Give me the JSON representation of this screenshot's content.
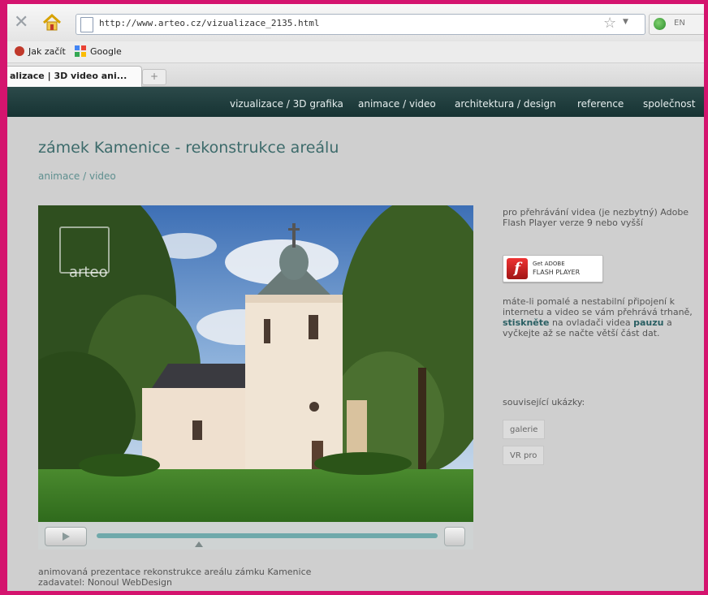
{
  "browser": {
    "url": "http://www.arteo.cz/vizualizace_2135.html",
    "extension_label": "EN",
    "tab_title": "alizace | 3D video ani...",
    "new_tab_symbol": "+",
    "bookmarks": [
      {
        "label": "Jak začít"
      },
      {
        "label": "Google"
      }
    ]
  },
  "site": {
    "nav": [
      {
        "label": "vizualizace / 3D grafika"
      },
      {
        "label": "animace / video"
      },
      {
        "label": "architektura / design"
      },
      {
        "label": "reference"
      },
      {
        "label": "společnost"
      }
    ],
    "page_title": "zámek Kamenice - rekonstrukce areálu",
    "category": "animace / video",
    "video": {
      "logo_text": "arteo",
      "progress": 0.3
    },
    "caption_line1": "animovaná prezentace rekonstrukce areálu zámku Kamenice",
    "caption_line2": "zadavatel: Nonoul WebDesign",
    "sidebar": {
      "flash_note": "pro přehrávání videa (je nezbytný) Adobe Flash Player verze 9 nebo vyšší",
      "flash_badge_line1": "Get ADOBE",
      "flash_badge_line2": "FLASH PLAYER",
      "slow_note_pre": "máte-li pomalé a nestabilní připojení k internetu a video se vám přehrává trhaně,",
      "slow_note_b1": "stiskněte",
      "slow_note_mid": "na ovladači videa",
      "slow_note_b2": "pauzu",
      "slow_note_post": "a vyčkejte až se načte větší část dat.",
      "related_label": "související ukázky:",
      "related": [
        {
          "label": "galerie"
        },
        {
          "label": "VR pro"
        }
      ]
    }
  }
}
